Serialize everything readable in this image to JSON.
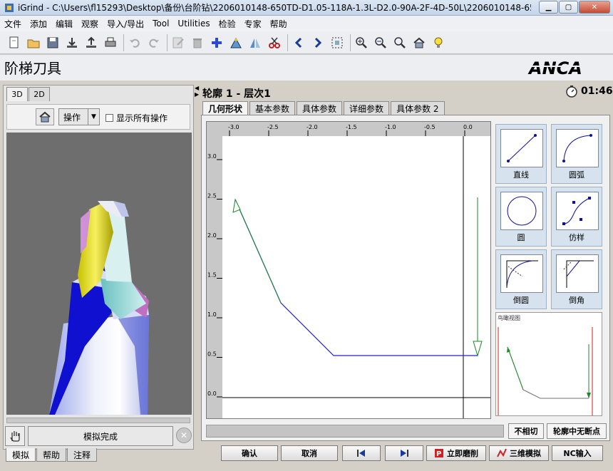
{
  "window": {
    "title": "iGrind - C:\\Users\\fl15293\\Desktop\\备份\\台阶钻\\2206010148-650TD-D1.05-118A-1.3L-D2.0-90A-2F-4D-50L\\2206010148-650TD-D1.05-118A-..."
  },
  "menu": {
    "items": [
      "文件",
      "添加",
      "编辑",
      "观察",
      "导入/导出",
      "Tool",
      "Utilities",
      "检验",
      "专家",
      "帮助"
    ]
  },
  "header": {
    "page_title": "阶梯刀具",
    "logo_text": "ANCA"
  },
  "left": {
    "view_tabs": [
      "3D",
      "2D"
    ],
    "ops_label": "操作",
    "show_all_ops_label": "显示所有操作",
    "sim_status": "模拟完成",
    "bottom_tabs": [
      "模拟",
      "帮助",
      "注释"
    ]
  },
  "right": {
    "profile_title": "轮廓 1 - 层次1",
    "timer": "01:46",
    "tabs": [
      "几何形状",
      "基本参数",
      "具体参数",
      "详细参数",
      "具体参数 2"
    ],
    "tools": [
      "直线",
      "圆弧",
      "圆",
      "仿样",
      "倒圆",
      "倒角"
    ],
    "thumbnail_title": "鸟瞰视图",
    "status_buttons": [
      "不相切",
      "轮廓中无断点"
    ],
    "footer_buttons": [
      "确认",
      "取消",
      "立即磨削",
      "三维模拟",
      "NC输入"
    ]
  },
  "plot": {
    "x_ticks": [
      "-3.0",
      "-2.5",
      "-2.0",
      "-1.5",
      "-1.0",
      "-0.5",
      "0.0"
    ],
    "y_ticks": [
      "3.0",
      "2.5",
      "2.0",
      "1.5",
      "1.0",
      "0.5",
      "0.0"
    ],
    "colors": {
      "profile_line": "#2020d0",
      "arrow": "#1a8a2a",
      "axis": "#000000"
    }
  }
}
